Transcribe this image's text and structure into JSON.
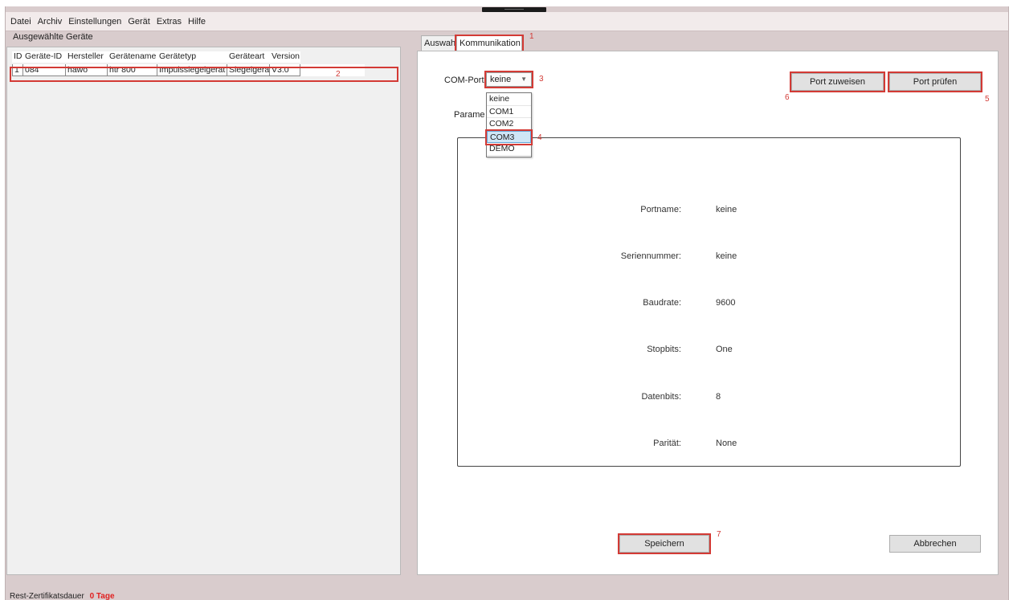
{
  "menu": [
    "Datei",
    "Archiv",
    "Einstellungen",
    "Gerät",
    "Extras",
    "Hilfe"
  ],
  "left": {
    "title": "Ausgewählte Geräte",
    "columns": [
      "ID",
      "Geräte-ID",
      "Hersteller",
      "Gerätename",
      "Gerätetyp",
      "Geräteart",
      "Version"
    ],
    "rows": [
      [
        "1",
        "084",
        "hawo",
        "htr 800",
        "Impulssiegelgerät",
        "Siegelgerät",
        "V3.0"
      ]
    ]
  },
  "tabs": [
    "Auswahl",
    "Kommunikation"
  ],
  "comm": {
    "com_port_label": "COM-Port",
    "com_port_value": "keine",
    "com_port_options": [
      "keine",
      "COM1",
      "COM2",
      "COM3",
      "DEMO"
    ],
    "params_label": "Parame",
    "port_zuweisen": "Port zuweisen",
    "port_pruefen": "Port prüfen",
    "params": [
      {
        "name": "Portname:",
        "value": "keine"
      },
      {
        "name": "Seriennummer:",
        "value": "keine"
      },
      {
        "name": "Baudrate:",
        "value": "9600"
      },
      {
        "name": "Stopbits:",
        "value": "One"
      },
      {
        "name": "Datenbits:",
        "value": "8"
      },
      {
        "name": "Parität:",
        "value": "None"
      }
    ],
    "speichern": "Speichern",
    "abbrechen": "Abbrechen"
  },
  "callouts": [
    "1",
    "2",
    "3",
    "4",
    "5",
    "6",
    "7"
  ],
  "status": {
    "label": "Rest-Zertifikatsdauer",
    "value": "0 Tage"
  },
  "colors": {
    "callout": "#d33a35",
    "window": "#d9cccd",
    "status_value": "#e02020"
  }
}
